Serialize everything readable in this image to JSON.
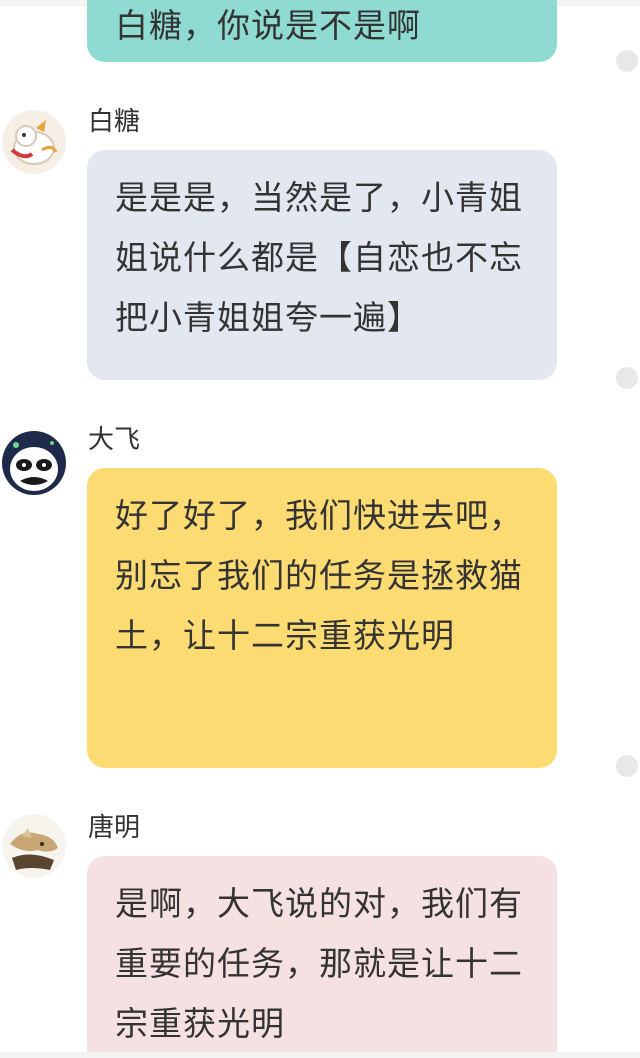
{
  "colors": {
    "teal": "#8fdbd1",
    "blue_gray": "#e3e7f0",
    "yellow": "#fcdb72",
    "pink": "#f5e1e2"
  },
  "messages": [
    {
      "sender": "",
      "text": "白糖，你说是不是啊",
      "color": "teal",
      "avatar": "none"
    },
    {
      "sender": "白糖",
      "text": "是是是，当然是了，小青姐姐说什么都是【自恋也不忘把小青姐姐夸一遍】",
      "color": "blue_gray",
      "avatar": "white-cat-avatar-icon"
    },
    {
      "sender": "大飞",
      "text": "好了好了，我们快进去吧，别忘了我们的任务是拯救猫土，让十二宗重获光明",
      "color": "yellow",
      "avatar": "panda-avatar-icon"
    },
    {
      "sender": "唐明",
      "text": "是啊，大飞说的对，我们有重要的任务，那就是让十二宗重获光明",
      "color": "pink",
      "avatar": "cat-avatar-icon"
    }
  ]
}
